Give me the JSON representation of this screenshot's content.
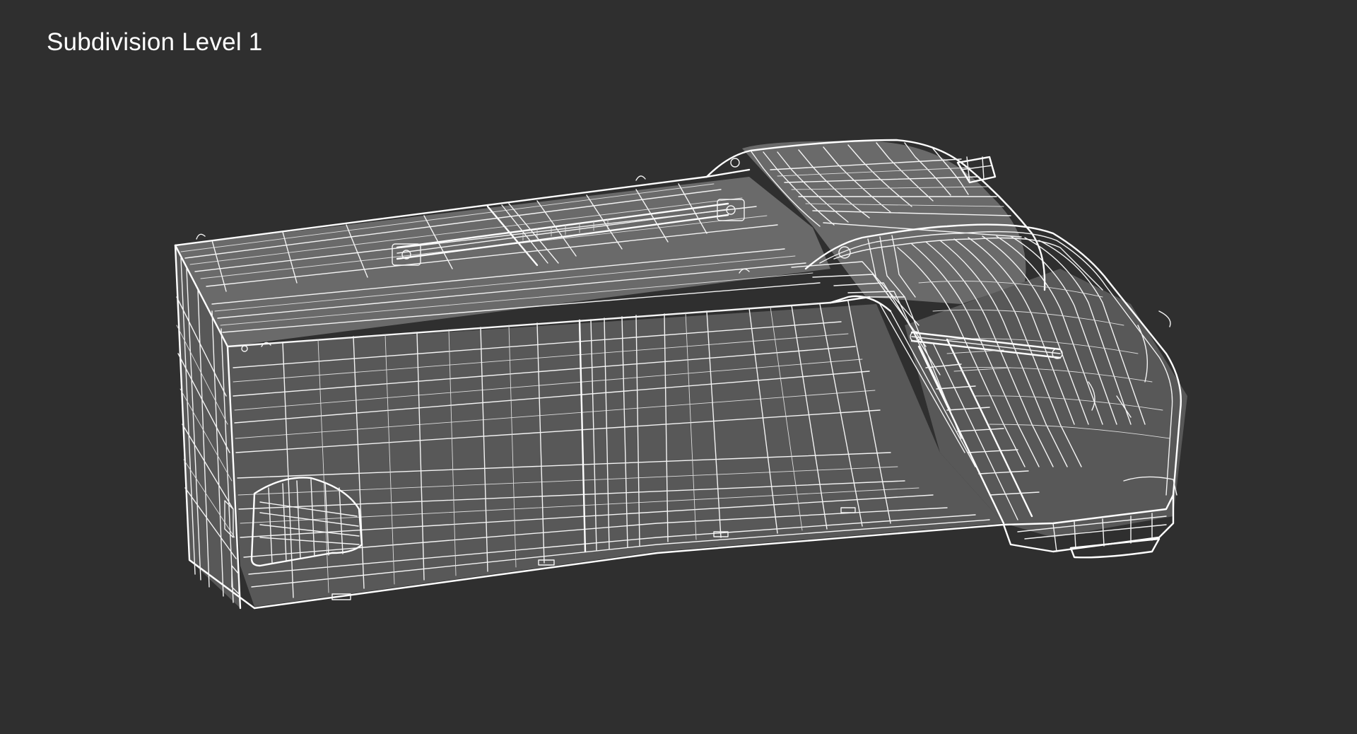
{
  "viewport": {
    "label": "Subdivision Level 1",
    "background_color": "#2f2f2f",
    "wire_color": "#f4f4f4"
  }
}
